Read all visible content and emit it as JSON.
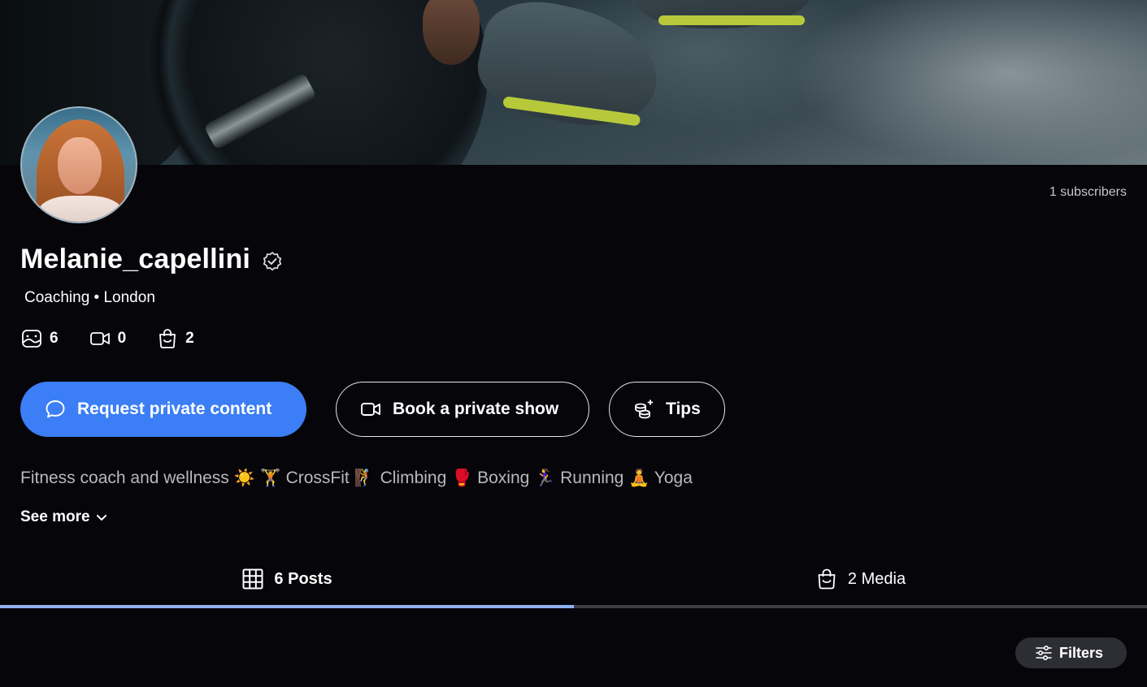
{
  "profile": {
    "name": "Melanie_capellini",
    "category": "Coaching • London",
    "subscribers": "1 subscribers",
    "stats": {
      "posts_count": "6",
      "videos_count": "0",
      "media_count": "2"
    },
    "bio": "Fitness coach and wellness ☀️ 🏋️ CrossFit 🧗 Climbing 🥊 Boxing 🏃‍♀️ Running 🧘 Yoga",
    "see_more_label": "See more"
  },
  "actions": {
    "request_label": "Request private content",
    "show_label": "Book a private show",
    "tips_label": "Tips"
  },
  "tabs": {
    "posts_label": "6 Posts",
    "media_label": "2 Media"
  },
  "filters_label": "Filters",
  "colors": {
    "background": "#05050a",
    "primary": "#3b7ef5",
    "tab_active": "#8fb0f2",
    "tab_inactive": "#3d3d44",
    "filters_bg": "#2d2e33"
  },
  "icons": {
    "verified": "verified-badge-icon",
    "posts": "image-icon",
    "videos": "video-icon",
    "media": "shopping-bag-icon",
    "request": "chat-bubble-icon",
    "show": "video-camera-icon",
    "tips": "coins-icon",
    "see_more": "chevron-down-icon",
    "grid": "grid-icon",
    "filters": "sliders-icon"
  }
}
